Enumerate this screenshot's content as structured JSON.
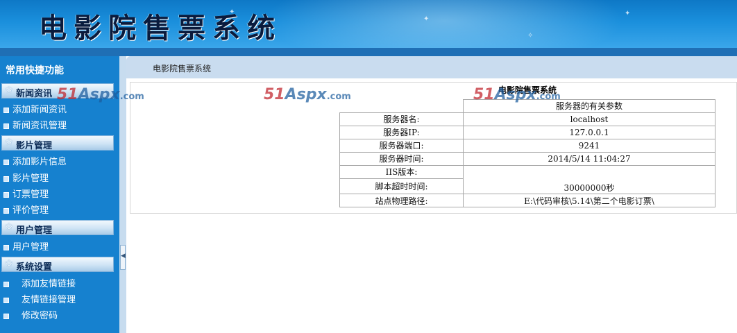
{
  "header": {
    "title": "电影院售票系统"
  },
  "sidebar": {
    "title": "常用快捷功能",
    "sections": [
      {
        "label": "新闻资讯",
        "items": [
          "添加新闻资讯",
          "新闻资讯管理"
        ]
      },
      {
        "label": "影片管理",
        "items": [
          "添加影片信息",
          "影片管理",
          "订票管理",
          "评价管理"
        ]
      },
      {
        "label": "用户管理",
        "items": [
          "用户管理"
        ]
      },
      {
        "label": "系统设置",
        "items": [
          "添加友情链接",
          "友情链接管理",
          "修改密码"
        ]
      }
    ]
  },
  "breadcrumb": "电影院售票系统",
  "info": {
    "title": "电影院售票系统",
    "subtitle": "服务器的有关参数",
    "rows": [
      {
        "key": "服务器名:",
        "value": "localhost"
      },
      {
        "key": "服务器IP:",
        "value": "127.0.0.1"
      },
      {
        "key": "服务器端口:",
        "value": "9241"
      },
      {
        "key": "服务器时间:",
        "value": "2014/5/14 11:04:27"
      },
      {
        "key": "IIS版本:",
        "value": ""
      },
      {
        "key": "脚本超时时间:",
        "value": "30000000秒"
      },
      {
        "key": "站点物理路径:",
        "value": "E:\\代码审核\\5.14\\第二个电影订票\\"
      }
    ]
  },
  "watermark": {
    "number": "51",
    "brand": "Aspx",
    "suffix": ".com"
  }
}
